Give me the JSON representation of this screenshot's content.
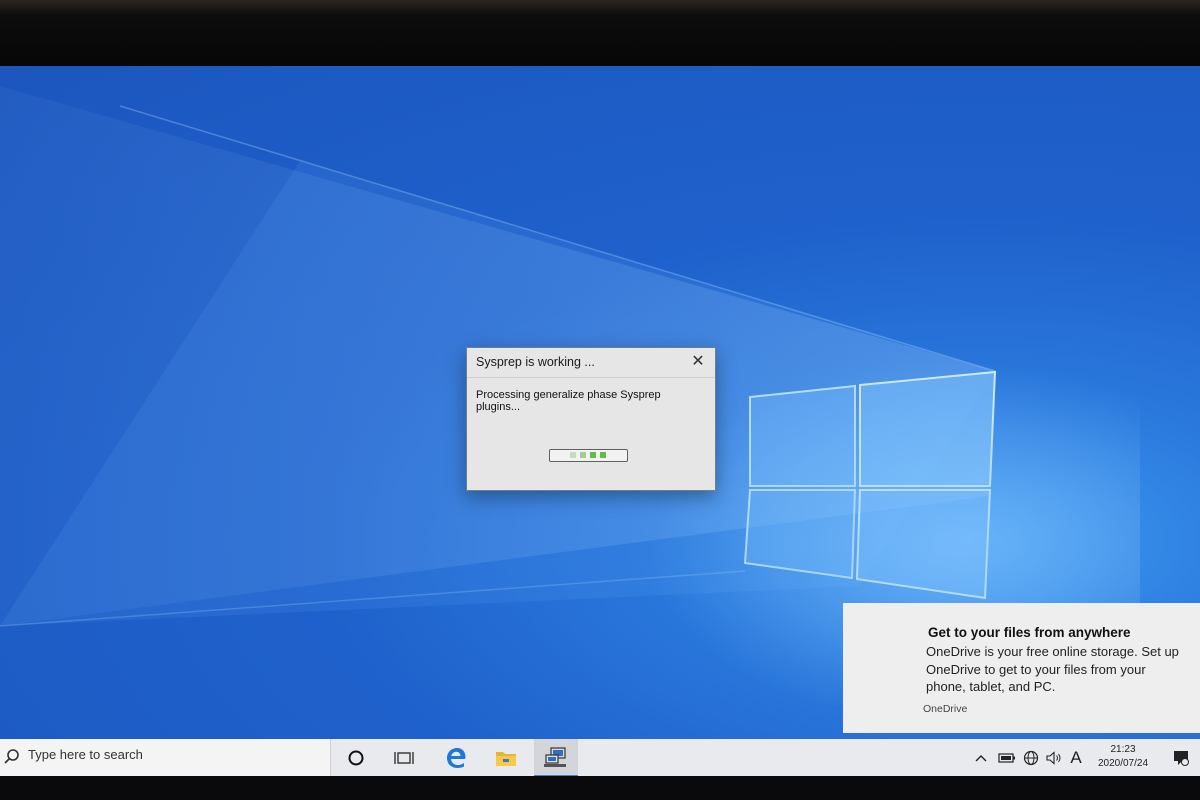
{
  "dialog": {
    "title": "Sysprep is working ...",
    "message": "Processing generalize phase Sysprep plugins...",
    "close_icon": "close-icon",
    "progress_state": "indeterminate"
  },
  "notification": {
    "title": "Get to your files from anywhere",
    "body": "OneDrive is your free online storage. Set up OneDrive to get to your files from your phone, tablet, and PC.",
    "source": "OneDrive"
  },
  "taskbar": {
    "search_placeholder": "Type here to search",
    "icons": [
      "cortana-icon",
      "task-view-icon",
      "edge-icon",
      "file-explorer-icon",
      "sysprep-app-icon"
    ],
    "tray": {
      "language_indicator": "A",
      "time": "21:23",
      "date": "2020/07/24"
    }
  },
  "colors": {
    "desktop_blue": "#1f61cc",
    "taskbar": "#e9eaee",
    "progress_green": "#5cbf4a"
  }
}
